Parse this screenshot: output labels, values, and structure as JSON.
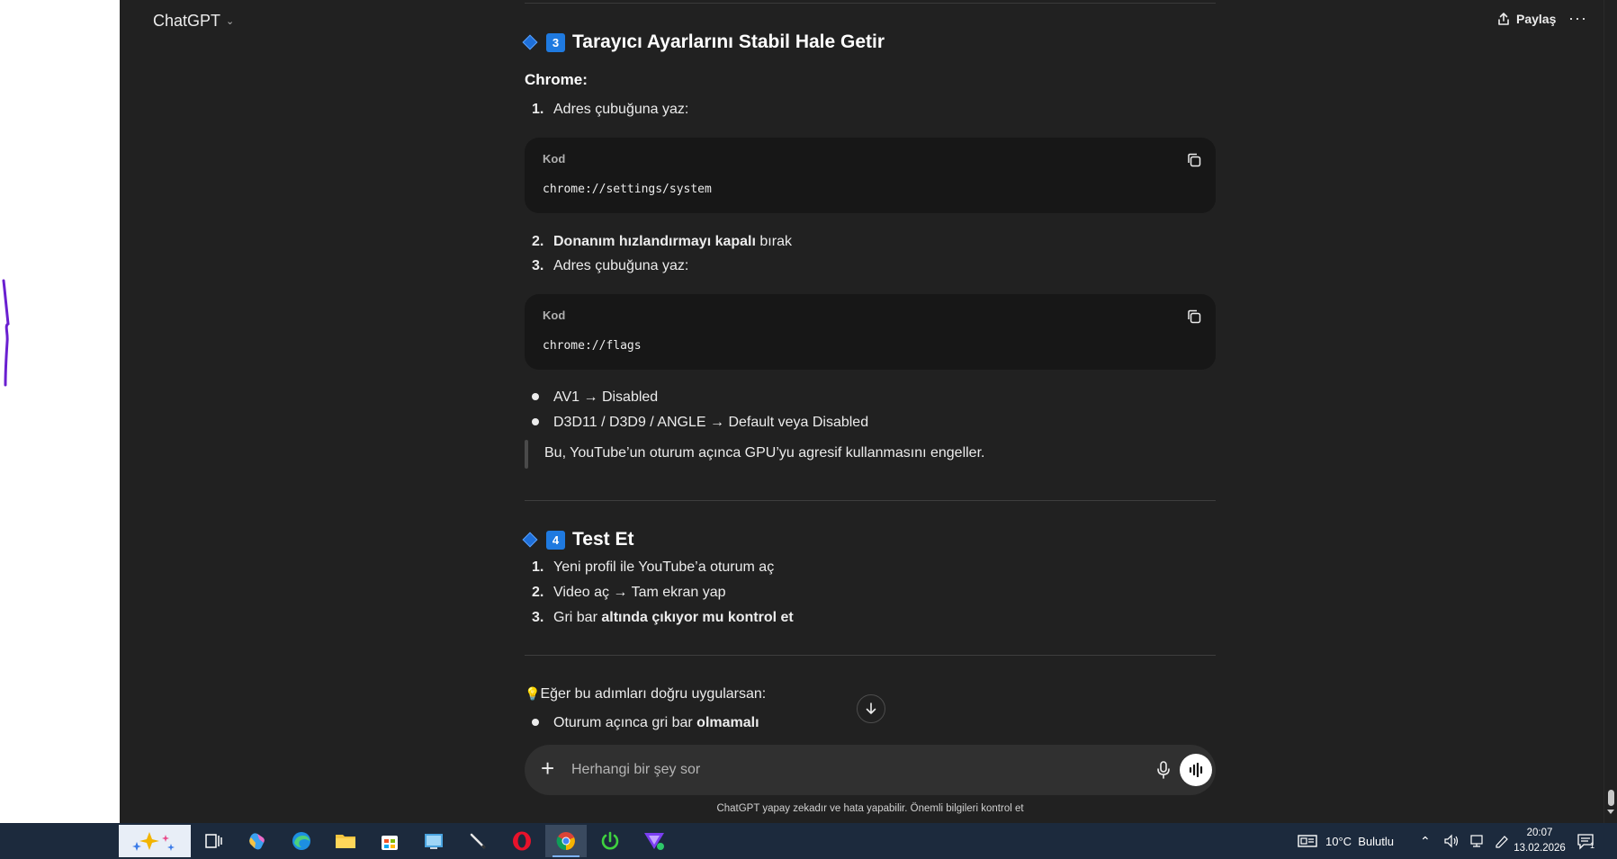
{
  "app": {
    "model_name": "ChatGPT",
    "share_label": "Paylaş",
    "more_label": "···"
  },
  "sections": {
    "s3": {
      "keycap": "3",
      "title": "Tarayıcı Ayarlarını Stabil Hale Getir"
    },
    "chrome_label": "Chrome:",
    "s3_items": [
      {
        "num": "1.",
        "text": "Adres çubuğuna yaz:"
      },
      {
        "num": "2.",
        "bold": "Donanım hızlandırmayı kapalı",
        "text": " bırak"
      },
      {
        "num": "3.",
        "text": "Adres çubuğuna yaz:"
      }
    ],
    "code1": {
      "lang": "Kod",
      "code": "chrome://settings/system"
    },
    "code2": {
      "lang": "Kod",
      "code": "chrome://flags"
    },
    "flags_bullets": [
      "AV1 → Disabled",
      "D3D11 / D3D9 / ANGLE → Default veya Disabled"
    ],
    "quote": "Bu, YouTube’un oturum açınca GPU’yu agresif kullanmasını engeller.",
    "s4": {
      "keycap": "4",
      "title": "Test Et"
    },
    "s4_items": [
      {
        "num": "1.",
        "text": "Yeni profil ile YouTube’a oturum aç"
      },
      {
        "num": "2.",
        "text": "Video aç → Tam ekran yap"
      },
      {
        "num": "3.",
        "text": "Gri bar ",
        "bold": "altında çıkıyor mu kontrol et"
      }
    ],
    "tip_icon": "💡",
    "tip": "Eğer bu adımları doğru uygularsan:",
    "tip_bullets": [
      {
        "text": "Oturum açınca gri bar ",
        "bold": "olmamalı"
      }
    ]
  },
  "composer": {
    "placeholder": "Herhangi bir şey sor"
  },
  "disclaimer": "ChatGPT yapay zekadır ve hata yapabilir. Önemli bilgileri kontrol et",
  "taskbar": {
    "weather": "10°C  Bulutlu",
    "time": "20:07",
    "date": "13.02.2026",
    "notifications": "1"
  },
  "colors": {
    "app_bg": "#212121",
    "code_bg": "#171717",
    "composer_bg": "#303030",
    "keycap": "#1f7ae0",
    "taskbar_bg": "#1c2a3d",
    "stroke": "#6a1fd0"
  }
}
